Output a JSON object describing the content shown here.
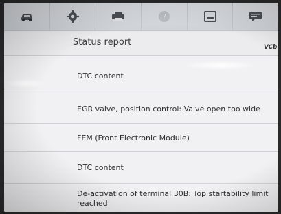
{
  "toolbar": {
    "icons": [
      "car-icon",
      "gear-icon",
      "printer-icon",
      "help-icon",
      "save-icon",
      "message-icon"
    ]
  },
  "header": {
    "title": "Status report",
    "badge": "VCb"
  },
  "rows": [
    {
      "label": "DTC content"
    },
    {
      "label": "EGR valve, position control: Valve open too wide"
    },
    {
      "label": "FEM (Front Electronic Module)"
    },
    {
      "label": "DTC content"
    },
    {
      "label": "De-activation of terminal 30B: Top startability limit"
    },
    {
      "label": "reached"
    }
  ]
}
